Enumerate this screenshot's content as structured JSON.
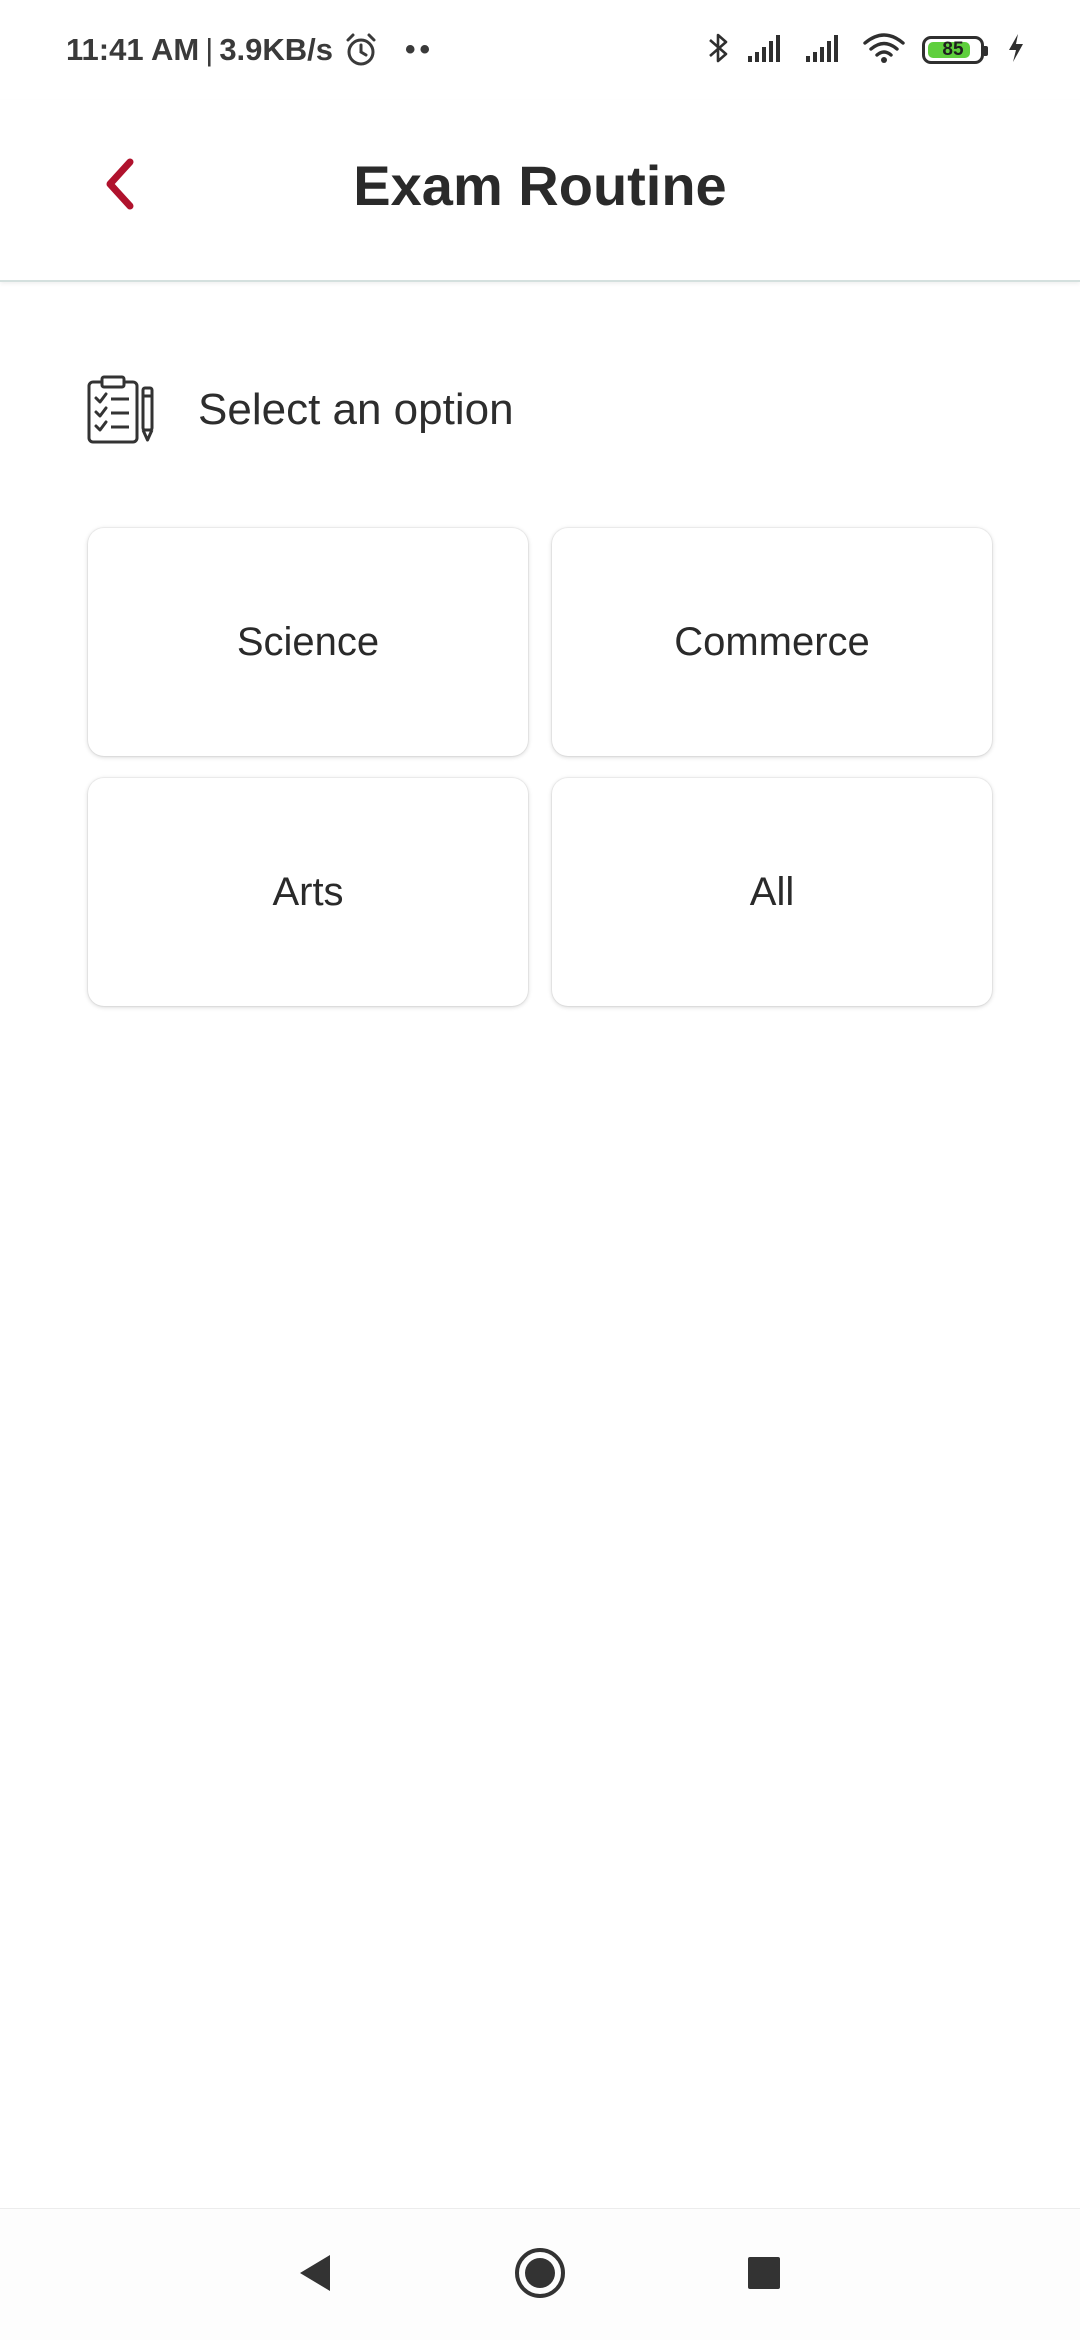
{
  "status_bar": {
    "time": "11:41 AM",
    "separator": "|",
    "network_speed": "3.9KB/s",
    "dots": "••",
    "battery_level": 85,
    "battery_text": "85",
    "battery_color": "#5fcf3d",
    "icons": [
      "alarm-icon",
      "bluetooth-icon",
      "signal-icon",
      "signal-icon",
      "wifi-icon",
      "battery-icon",
      "charging-icon"
    ]
  },
  "header": {
    "title": "Exam Routine",
    "back_icon": "chevron-left-icon",
    "accent_color": "#b0122d"
  },
  "prompt": {
    "icon": "checklist-clipboard-icon",
    "text": "Select an option"
  },
  "options": [
    {
      "label": "Science"
    },
    {
      "label": "Commerce"
    },
    {
      "label": "Arts"
    },
    {
      "label": "All"
    }
  ],
  "nav_bar": {
    "icons": [
      "nav-back-icon",
      "nav-home-icon",
      "nav-recents-icon"
    ]
  }
}
